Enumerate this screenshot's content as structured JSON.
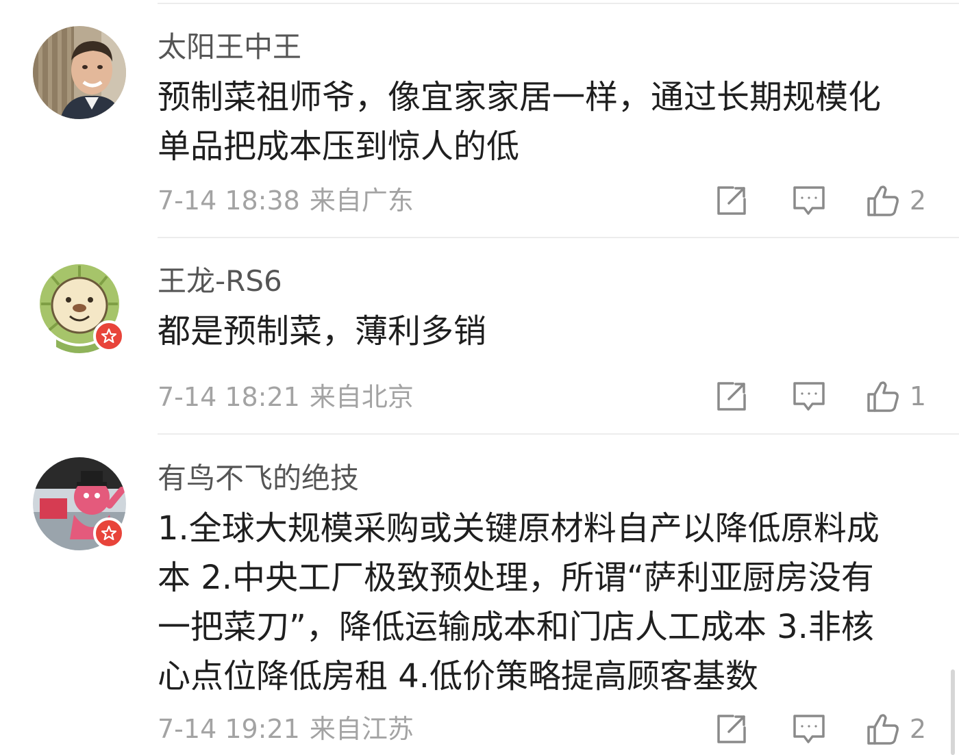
{
  "comments": [
    {
      "username": "太阳王中王",
      "content_lines": [
        "预制菜祖师爷，像宜家家居一样，通过长期规模化",
        "单品把成本压到惊人的低"
      ],
      "time": "7-14 18:38",
      "location": "来自广东",
      "likes": "2",
      "avatar_icon": "portrait-avatar-icon",
      "verified": false
    },
    {
      "username": "王龙-RS6",
      "content_lines": [
        "都是预制菜，薄利多销"
      ],
      "time": "7-14 18:21",
      "location": "来自北京",
      "likes": "1",
      "avatar_icon": "cartoon-lion-avatar-icon",
      "verified": true
    },
    {
      "username": "有鸟不飞的绝技",
      "content_lines": [
        "1.全球大规模采购或关键原材料自产以降低原料成",
        "本 2.中央工厂极致预处理，所谓“萨利亚厨房没有",
        "一把菜刀”，降低运输成本和门店人工成本 3.非核",
        "心点位降低房租 4.低价策略提高顾客基数"
      ],
      "time": "7-14 19:21",
      "location": "来自江苏",
      "likes": "2",
      "avatar_icon": "pink-mascot-avatar-icon",
      "verified": true
    }
  ],
  "icons": {
    "share": "share-icon",
    "reply": "comment-icon",
    "like": "thumbs-up-icon",
    "badge": "verified-badge-icon"
  },
  "colors": {
    "username": "#555555",
    "content": "#1f1f1f",
    "meta": "#a3a3a3",
    "icon": "#8a8a8a",
    "badge": "#e8443a",
    "divider": "#ececec"
  }
}
